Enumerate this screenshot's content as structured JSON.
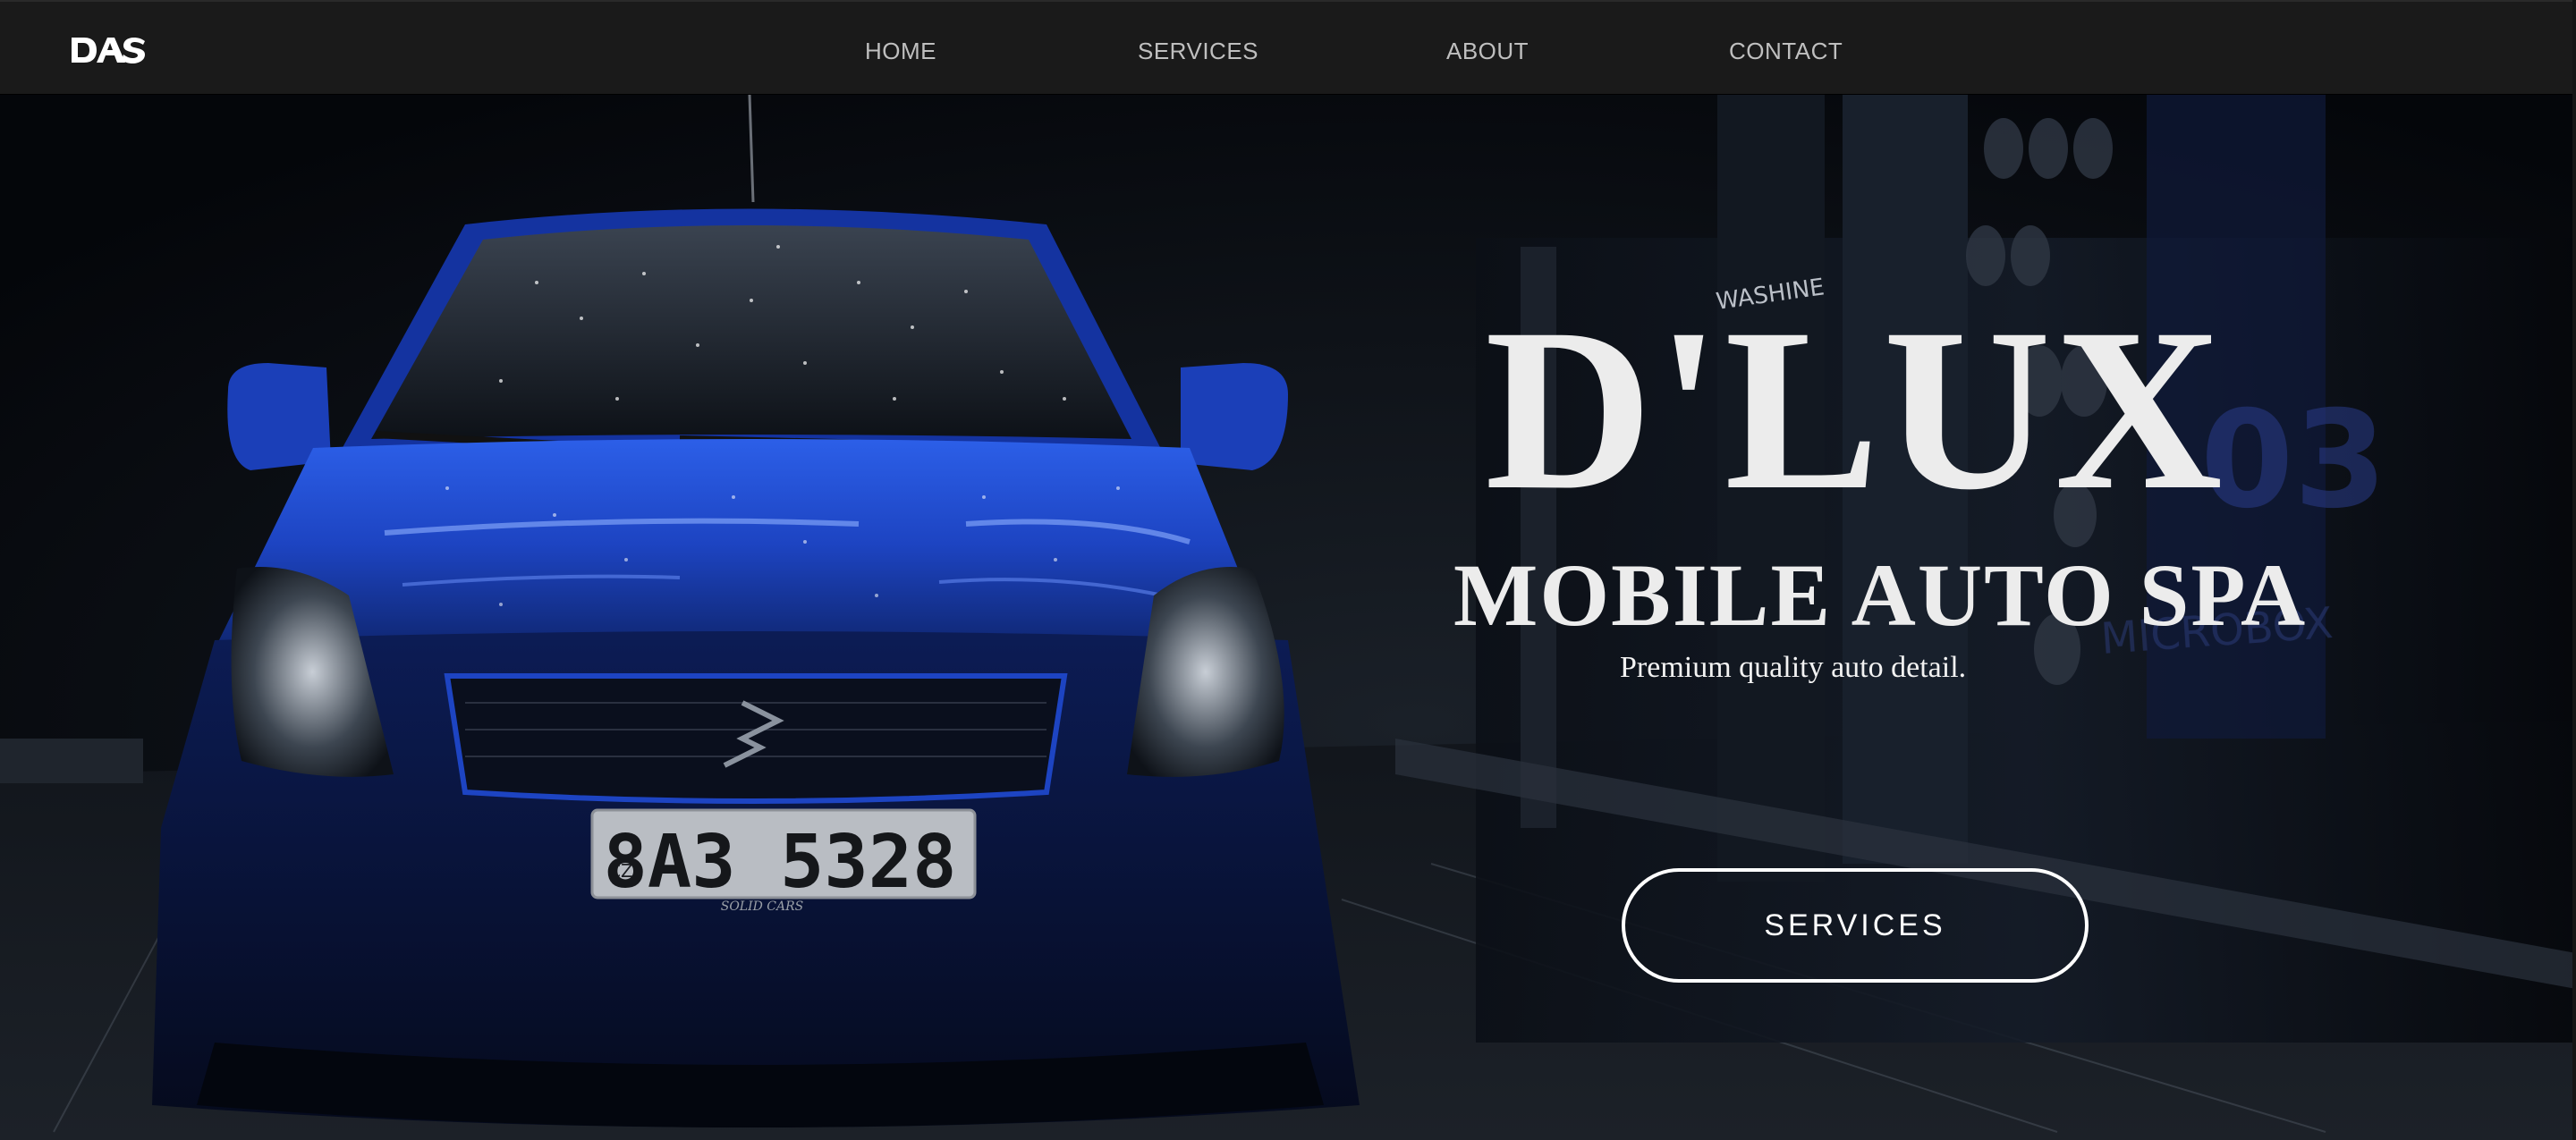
{
  "brand": {
    "logo_text": "DAS"
  },
  "nav": {
    "items": [
      {
        "label": "HOME"
      },
      {
        "label": "SERVICES"
      },
      {
        "label": "ABOUT"
      },
      {
        "label": "CONTACT"
      }
    ]
  },
  "hero": {
    "title": "D'LUX",
    "subtitle": "MOBILE AUTO SPA",
    "tagline": "Premium quality auto detail.",
    "cta_label": "SERVICES",
    "car_plate": "8A3 5328",
    "car_plate_prefix": "CZ",
    "plate_frame_text": "SOLID CARS",
    "sign_text": "WASHINE",
    "background_text": "03 MICROBOX"
  },
  "colors": {
    "navbar_bg": "#1a1a1a",
    "nav_text": "#bfbfbf",
    "hero_text": "#ececec",
    "car_blue": "#1a3fb5",
    "button_border": "#ffffff"
  },
  "icons": {
    "logo": "das-logo-icon"
  }
}
